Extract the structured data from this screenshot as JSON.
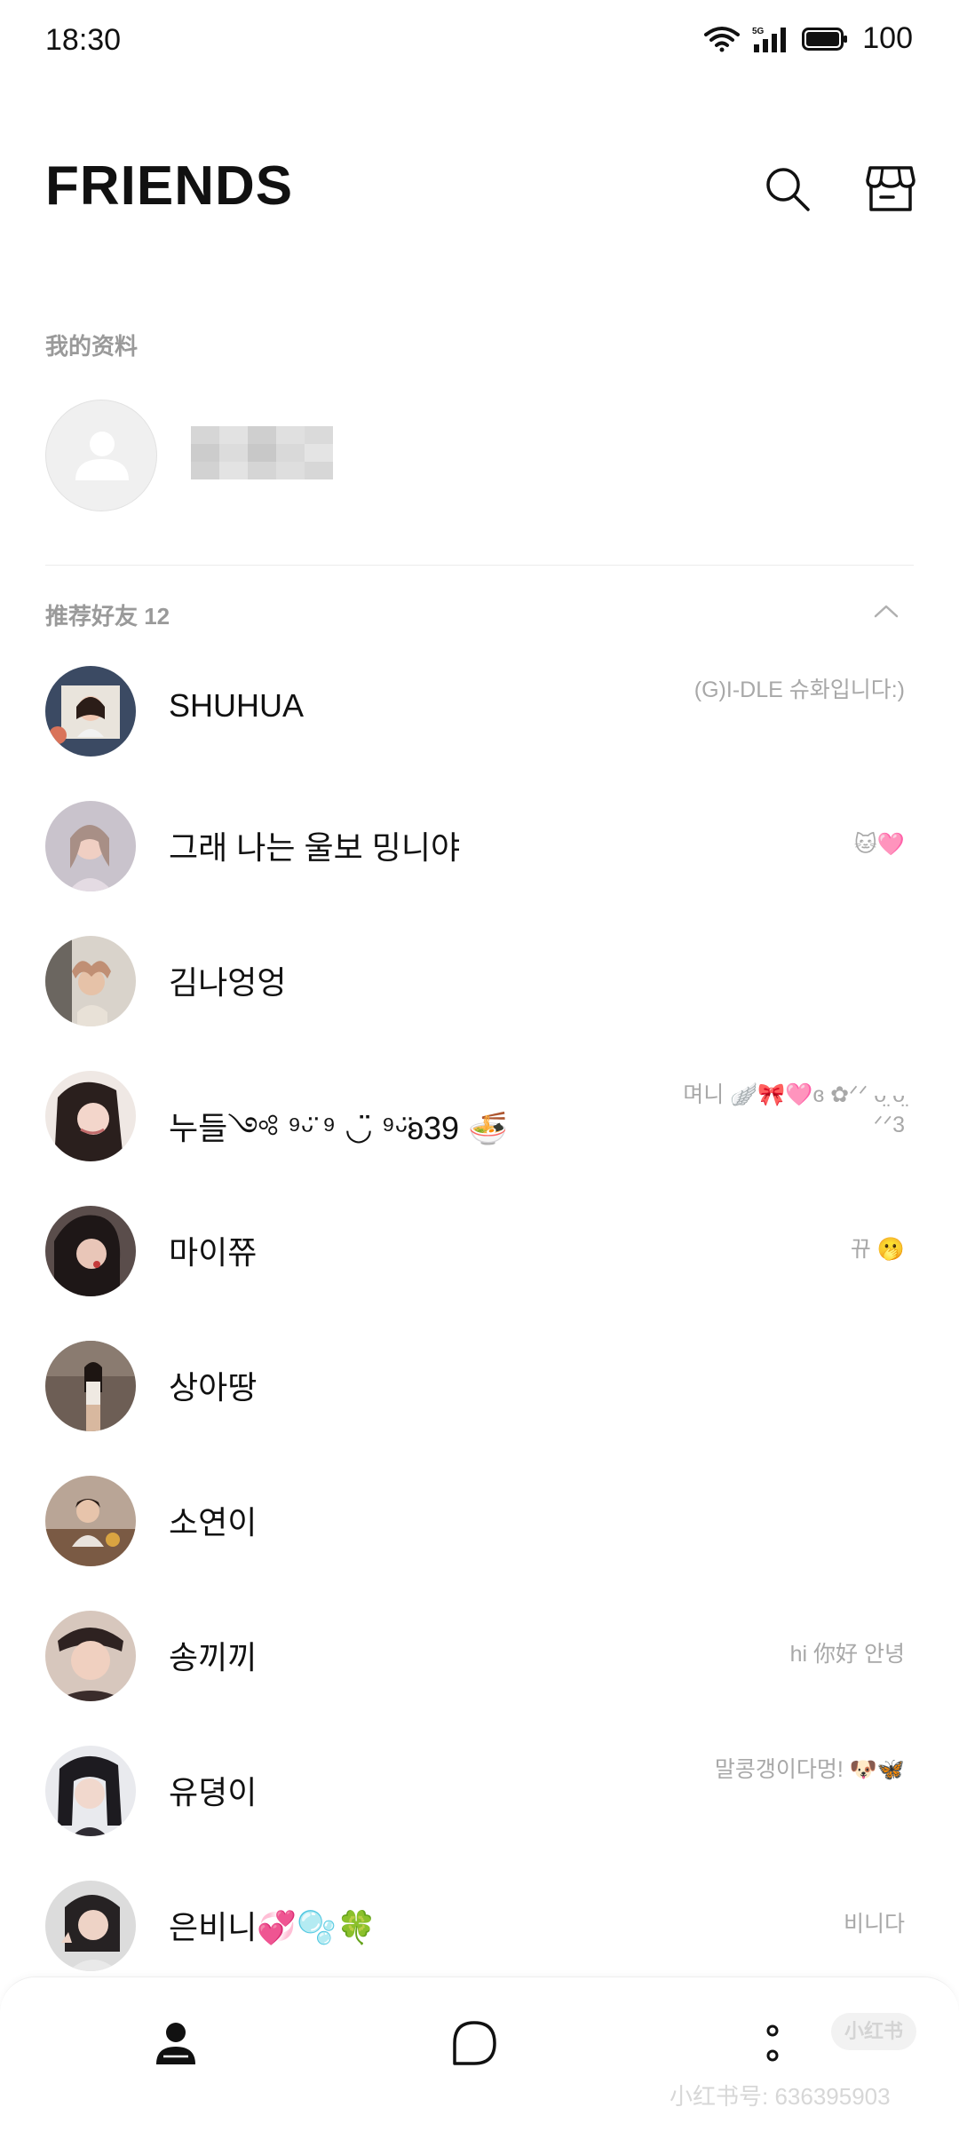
{
  "status_bar": {
    "time": "18:30",
    "network": "5G",
    "battery_percent": "100"
  },
  "header": {
    "title": "FRIENDS",
    "icons": [
      "search-icon",
      "shop-icon"
    ]
  },
  "my_profile": {
    "section_label": "我的资料"
  },
  "recommended": {
    "section_label": "推荐好友 12",
    "friends": [
      {
        "name": "SHUHUA",
        "status": "(G)I-DLE 슈화입니다:)"
      },
      {
        "name": "그래 나는 울보 밍니야",
        "status": "🐱🩷"
      },
      {
        "name": "김나엉엉",
        "status": ""
      },
      {
        "name": "누들༺ ⁹ᵕ̈ ⁹ ◡̈ ⁹ᵕ̈ʚ39 🍜",
        "status": "며니 🪽🎀🩷ɞ ✿ᐟᐟ ᴗ̤ ᴗ̤ ᐟᐟ3"
      },
      {
        "name": "마이쮸",
        "status": "뀨 🫢"
      },
      {
        "name": "상아땅",
        "status": ""
      },
      {
        "name": "소연이",
        "status": ""
      },
      {
        "name": "송끼끼",
        "status": "hi 你好 안녕"
      },
      {
        "name": "유뎡이",
        "status": "말콩갱이다멍! 🐶🦋"
      },
      {
        "name": "은비니💞🫧🍀",
        "status": "비니다"
      }
    ]
  },
  "bottom_nav": {
    "items": [
      "friends-tab",
      "chats-tab",
      "more-tab"
    ],
    "watermark_logo": "小红书",
    "watermark_text": "小红书号: 636395903"
  },
  "colors": {
    "text_primary": "#111111",
    "text_secondary": "#9a9a9a",
    "divider": "#ececec",
    "background": "#ffffff"
  }
}
